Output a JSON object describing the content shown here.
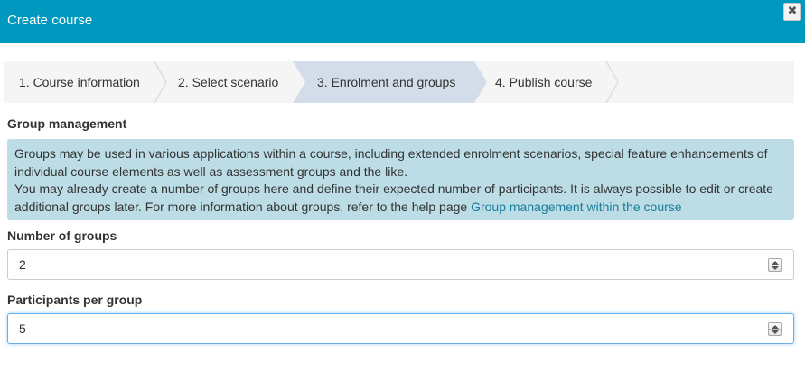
{
  "dialog": {
    "title": "Create course",
    "close_glyph": "✖",
    "close_icon": "close-icon"
  },
  "wizard": {
    "steps": [
      {
        "label": "1. Course information",
        "state": "done"
      },
      {
        "label": "2. Select scenario",
        "state": "done"
      },
      {
        "label": "3. Enrolment and groups",
        "state": "active"
      },
      {
        "label": "4. Publish course",
        "state": "pending"
      }
    ],
    "active_color": "#d2dde9",
    "inactive_color": "#f5f5f5"
  },
  "group_management": {
    "title": "Group management",
    "info_line1": "Groups may be used in various applications within a course, including extended enrolment scenarios, special feature enhancements of individual course elements as well as assessment groups and the like.",
    "info_line2": "You may already create a number of groups here and define their expected number of participants. It is always possible to edit or create additional groups later. For more information about groups, refer to the help page ",
    "help_link": "Group management within the course"
  },
  "fields": {
    "number_of_groups": {
      "label": "Number of groups",
      "value": "2"
    },
    "participants_per_group": {
      "label": "Participants per group",
      "value": "5"
    }
  },
  "colors": {
    "header": "#0098be",
    "info_bg": "#bcdde6",
    "link": "#1a7d9b",
    "focus": "#66afe9"
  }
}
